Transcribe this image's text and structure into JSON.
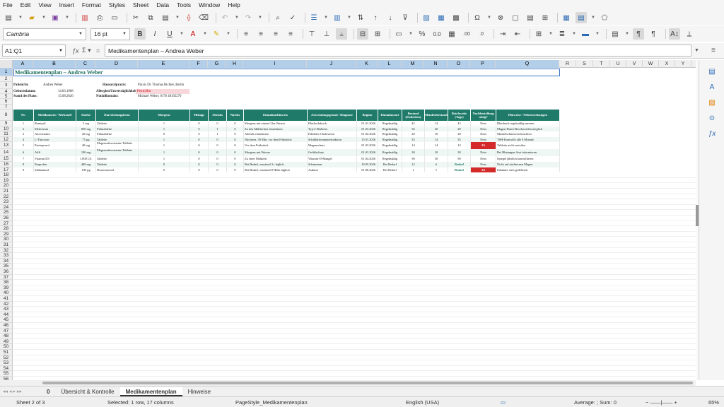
{
  "menu": [
    "File",
    "Edit",
    "View",
    "Insert",
    "Format",
    "Styles",
    "Sheet",
    "Data",
    "Tools",
    "Window",
    "Help"
  ],
  "font_name": "Cambria",
  "font_size": "16 pt",
  "name_box": "A1:Q1",
  "formula_text": "Medikamentenplan – Andrea Weber",
  "columns": [
    "A",
    "B",
    "C",
    "D",
    "E",
    "F",
    "G",
    "H",
    "I",
    "J",
    "K",
    "L",
    "M",
    "N",
    "O",
    "P",
    "Q",
    "R",
    "S",
    "T",
    "U",
    "V",
    "W",
    "X",
    "Y"
  ],
  "rows": [
    "1",
    "2",
    "3",
    "4",
    "5",
    "6",
    "7",
    "8",
    "9",
    "10",
    "11",
    "12",
    "13",
    "14",
    "15",
    "16",
    "17",
    "18",
    "19",
    "20",
    "21",
    "22",
    "23",
    "24",
    "25",
    "26",
    "27",
    "28",
    "29",
    "30",
    "31",
    "32",
    "33",
    "34",
    "35",
    "36",
    "37",
    "38",
    "39",
    "40",
    "41",
    "42",
    "43",
    "44",
    "45",
    "46",
    "47",
    "48",
    "49",
    "50",
    "51",
    "52",
    "53",
    "54",
    "55",
    "56",
    "57",
    "58",
    "59"
  ],
  "title": "Medikamentenplan – Andrea Weber",
  "meta": {
    "patient_label": "Patient/in:",
    "patient": "Andrea Weber",
    "birth_label": "Geburtsdatum:",
    "birth": "14.03.1968",
    "status_label": "Stand des Plans:",
    "status": "15.08.2026",
    "doctor_label": "Hausarztpraxis:",
    "doctor": "Praxis Dr. Thomas Richter, Berlin",
    "allergy_label": "Allergien/Unverträglichkeiten:",
    "allergy": "Penicillin",
    "emergency_label": "Notfallkontakt:",
    "emergency": "Michael Weber, 0176 48192270"
  },
  "headers": [
    "Nr.",
    "Medikament / Wirkstoff",
    "Stärke",
    "Darreichungsform",
    "Morgens",
    "Mittags",
    "Abends",
    "Nachts",
    "Einnahmehinweis",
    "Anwendungsgrund / Diagnose",
    "Beginn",
    "Einnahmeart",
    "Bestand (Einheiten)",
    "Mindestbestand",
    "Reichweite (Tage)",
    "Nachbestellung nötig?",
    "Hinweise / Nebenwirkungen"
  ],
  "table": [
    [
      "1",
      "Ramipril",
      "5 mg",
      "Tablette",
      "1",
      "0",
      "0",
      "0",
      "Morgens mit einem Glas Wasser",
      "Bluthochdruck",
      "01.01.2026",
      "Regelmäßig",
      "42",
      "14",
      "42",
      "Nein",
      "Blutdruck regelmäßig messen"
    ],
    [
      "2",
      "Metformin",
      "850 mg",
      "Filmtablette",
      "1",
      "0",
      "1",
      "0",
      "Zu den Mahlzeiten einnehmen",
      "Typ-2-Diabetes",
      "01.03.2026",
      "Regelmäßig",
      "56",
      "20",
      "28",
      "Nein",
      "Magen-Darm-Beschwerden möglich"
    ],
    [
      "3",
      "Atorvastatin",
      "20 mg",
      "Filmtablette",
      "0",
      "0",
      "1",
      "0",
      "Abends einnehmen",
      "Erhöhtes Cholesterin",
      "01.02.2026",
      "Regelmäßig",
      "28",
      "10",
      "28",
      "Nein",
      "Muskelschmerzen beachten"
    ],
    [
      "4",
      "L-Thyroxin",
      "75 µg",
      "Tablette",
      "1",
      "0",
      "0",
      "0",
      "Nüchtern, 30 Min. vor dem Frühstück",
      "Schilddrüsenunterfunktion",
      "15.01.2026",
      "Regelmäßig",
      "35",
      "14",
      "35",
      "Nein",
      "TSH-Kontrolle alle 6 Monate"
    ],
    [
      "5",
      "Pantoprazol",
      "40 mg",
      "Magensaftresistente Tablette",
      "1",
      "0",
      "0",
      "0",
      "Vor dem Frühstück",
      "Magenschutz",
      "01.03.2026",
      "Regelmäßig",
      "14",
      "14",
      "14",
      "JA",
      "Tablette nicht zerteilen"
    ],
    [
      "6",
      "ASS",
      "100 mg",
      "Magensaftresistente Tablette",
      "1",
      "0",
      "0",
      "0",
      "Morgens mit Wasser",
      "Gefäßschutz",
      "01.01.2026",
      "Regelmäßig",
      "30",
      "10",
      "30",
      "Nein",
      "Bei Blutungen Arzt informieren"
    ],
    [
      "7",
      "Vitamin D3",
      "1.000 I.E.",
      "Tablette",
      "1",
      "0",
      "0",
      "0",
      "Zu einer Mahlzeit",
      "Vitamin-D-Mangel",
      "01.04.2026",
      "Regelmäßig",
      "90",
      "30",
      "90",
      "Nein",
      "Spiegel jährlich kontrollieren"
    ],
    [
      "8",
      "Ibuprofen",
      "400 mg",
      "Tablette",
      "0",
      "0",
      "0",
      "0",
      "Bei Bedarf, maximal 3× täglich",
      "Schmerzen",
      "10.05.2026",
      "Bei Bedarf",
      "12",
      "6",
      "Bedarf",
      "Nein",
      "Nicht auf nüchternen Magen"
    ],
    [
      "9",
      "Salbutamol",
      "100 µg",
      "Dosieraerosol",
      "0",
      "0",
      "0",
      "0",
      "Bei Bedarf, maximal 8 Hübe täglich",
      "Asthma",
      "01.06.2026",
      "Bei Bedarf",
      "1",
      "1",
      "Bedarf",
      "JA",
      "Inhalator stets griffbereit"
    ]
  ],
  "sheet_tabs": [
    "Übersicht & Kontrolle",
    "Medikamentenplan",
    "Hinweise"
  ],
  "tab_nav": "0",
  "status": {
    "sheet": "Sheet 2 of 3",
    "selection": "Selected: 1 row, 17 columns",
    "page_style": "PageStyle_Medikamentenplan",
    "language": "English (USA)",
    "summary": "Average: ; Sum: 0",
    "zoom": "65%"
  },
  "colors": {
    "header_green": "#1f7a6a",
    "alert_red": "#d42a2a",
    "selection_blue": "#b3cee8"
  }
}
